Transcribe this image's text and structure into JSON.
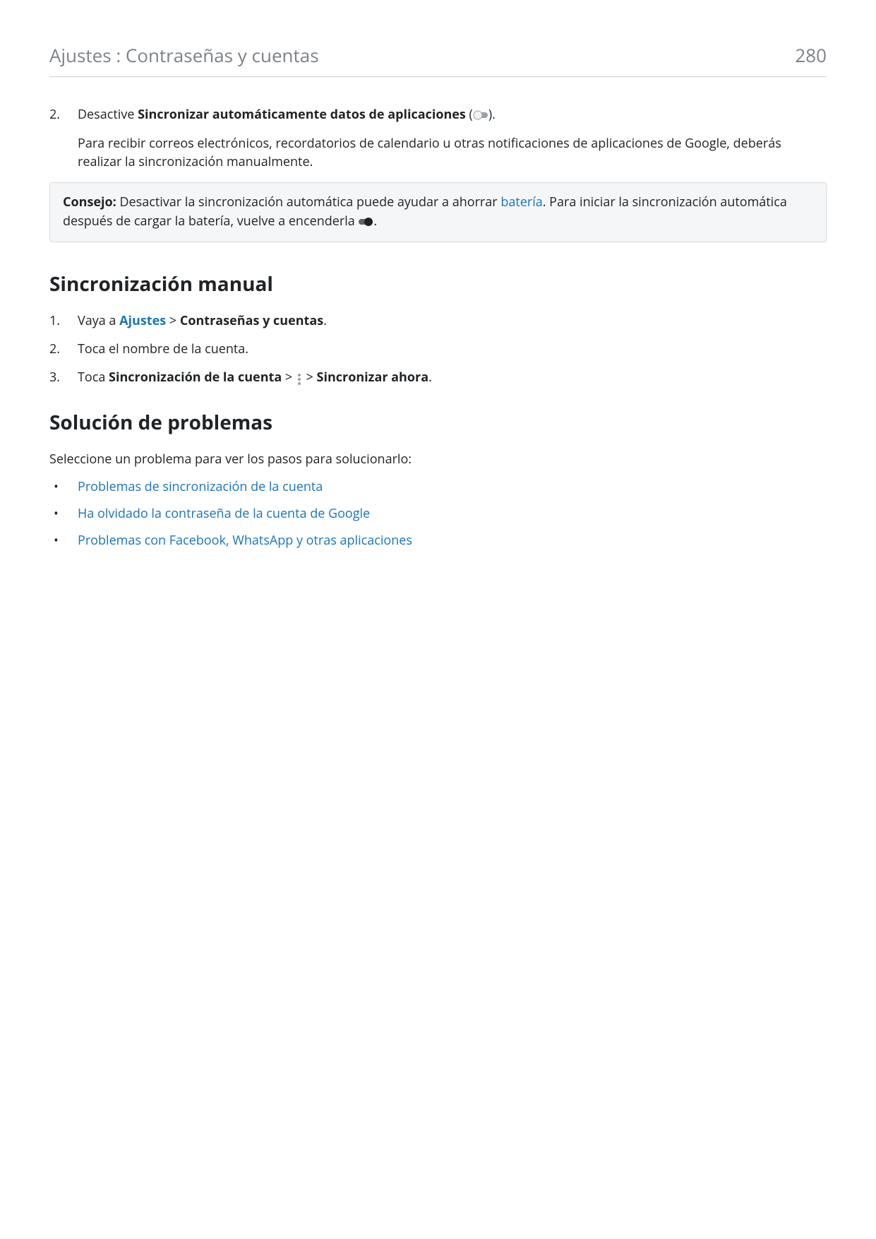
{
  "header": {
    "breadcrumb": "Ajustes : Contraseñas y cuentas",
    "page_number": "280"
  },
  "step2": {
    "num": "2.",
    "text_before": "Desactive ",
    "bold": "Sincronizar automáticamente datos de aplicaciones",
    "text_after_open": " (",
    "text_after_close": ").",
    "paragraph": "Para recibir correos electrónicos, recordatorios de calendario u otras notificaciones de aplicaciones de Google, deberás realizar la sincronización manualmente."
  },
  "tip": {
    "label": "Consejo:",
    "text1": " Desactivar la sincronización automática puede ayudar a ahorrar ",
    "link": "batería",
    "text2": ". Para iniciar la sincronización automática después de cargar la batería, vuelve a encenderla ",
    "text3": "."
  },
  "section_manual": {
    "heading": "Sincronización manual",
    "items": [
      {
        "num": "1.",
        "pre": "Vaya a ",
        "link": "Ajustes",
        "mid": " > ",
        "bold": "Contraseñas y cuentas",
        "post": "."
      },
      {
        "num": "2.",
        "text": "Toca el nombre de la cuenta."
      },
      {
        "num": "3.",
        "pre": "Toca ",
        "bold1": "Sincronización de la cuenta",
        "mid1": " > ",
        "mid2": " > ",
        "bold2": "Sincronizar ahora",
        "post": "."
      }
    ]
  },
  "section_troubleshoot": {
    "heading": "Solución de problemas",
    "intro": "Seleccione un problema para ver los pasos para solucionarlo:",
    "links": [
      "Problemas de sincronización de la cuenta",
      "Ha olvidado la contraseña de la cuenta de Google",
      "Problemas con Facebook, WhatsApp y otras aplicaciones"
    ]
  }
}
